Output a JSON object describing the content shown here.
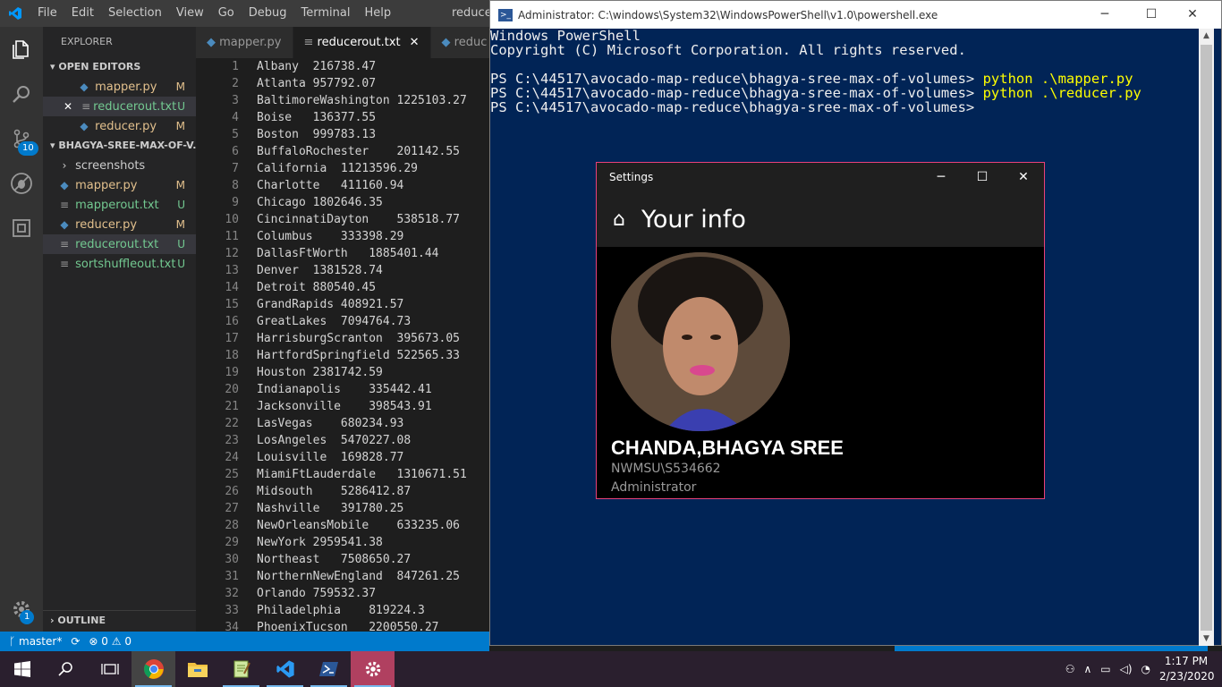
{
  "vscode": {
    "menu": [
      "File",
      "Edit",
      "Selection",
      "View",
      "Go",
      "Debug",
      "Terminal",
      "Help"
    ],
    "window_title": "reducer",
    "activity_badge_scm": "10",
    "activity_badge_settings": "1",
    "explorer_title": "EXPLORER",
    "open_editors_title": "OPEN EDITORS",
    "open_editors": [
      {
        "name": "mapper.py",
        "status": "M"
      },
      {
        "name": "reducerout.txt",
        "status": "U"
      },
      {
        "name": "reducer.py",
        "status": "M"
      }
    ],
    "folder_title": "BHAGYA-SREE-MAX-OF-V...",
    "folder_items": [
      {
        "name": "screenshots",
        "status": ""
      },
      {
        "name": "mapper.py",
        "status": "M"
      },
      {
        "name": "mapperout.txt",
        "status": "U"
      },
      {
        "name": "reducer.py",
        "status": "M"
      },
      {
        "name": "reducerout.txt",
        "status": "U"
      },
      {
        "name": "sortshuffleout.txt",
        "status": "U"
      }
    ],
    "outline_title": "OUTLINE",
    "tabs": [
      "mapper.py",
      "reducerout.txt",
      "reduc"
    ],
    "lines": [
      "Albany  216738.47",
      "Atlanta 957792.07",
      "BaltimoreWashington 1225103.27",
      "Boise   136377.55",
      "Boston  999783.13",
      "BuffaloRochester    201142.55",
      "California  11213596.29",
      "Charlotte   411160.94",
      "Chicago 1802646.35",
      "CincinnatiDayton    538518.77",
      "Columbus    333398.29",
      "DallasFtWorth   1885401.44",
      "Denver  1381528.74",
      "Detroit 880540.45",
      "GrandRapids 408921.57",
      "GreatLakes  7094764.73",
      "HarrisburgScranton  395673.05",
      "HartfordSpringfield 522565.33",
      "Houston 2381742.59",
      "Indianapolis    335442.41",
      "Jacksonville    398543.91",
      "LasVegas    680234.93",
      "LosAngeles  5470227.08",
      "Louisville  169828.77",
      "MiamiFtLauderdale   1310671.51",
      "Midsouth    5286412.87",
      "Nashville   391780.25",
      "NewOrleansMobile    633235.06",
      "NewYork 2959541.38",
      "Northeast   7508650.27",
      "NorthernNewEngland  847261.25",
      "Orlando 759532.37",
      "Philadelphia    819224.3",
      "PhoenixTucson   2200550.27"
    ],
    "status_branch": "master*",
    "status_errors": "0",
    "status_warnings": "0"
  },
  "powershell": {
    "title": "Administrator: C:\\windows\\System32\\WindowsPowerShell\\v1.0\\powershell.exe",
    "line1": "Windows PowerShell",
    "line2": "Copyright (C) Microsoft Corporation. All rights reserved.",
    "prompt": "PS C:\\44517\\avocado-map-reduce\\bhagya-sree-max-of-volumes> ",
    "cmd1": "python .\\mapper.py",
    "cmd2": "python .\\reducer.py",
    "prompt3": "PS C:\\44517\\avocado-map-reduce\\bhagya-sree-max-of-volumes>"
  },
  "settings": {
    "window_title": "Settings",
    "heading": "Your info",
    "name": "CHANDA,BHAGYA SREE",
    "domain": "NWMSU\\S534662",
    "role": "Administrator"
  },
  "taskbar": {
    "time": "1:17 PM",
    "date": "2/23/2020"
  }
}
